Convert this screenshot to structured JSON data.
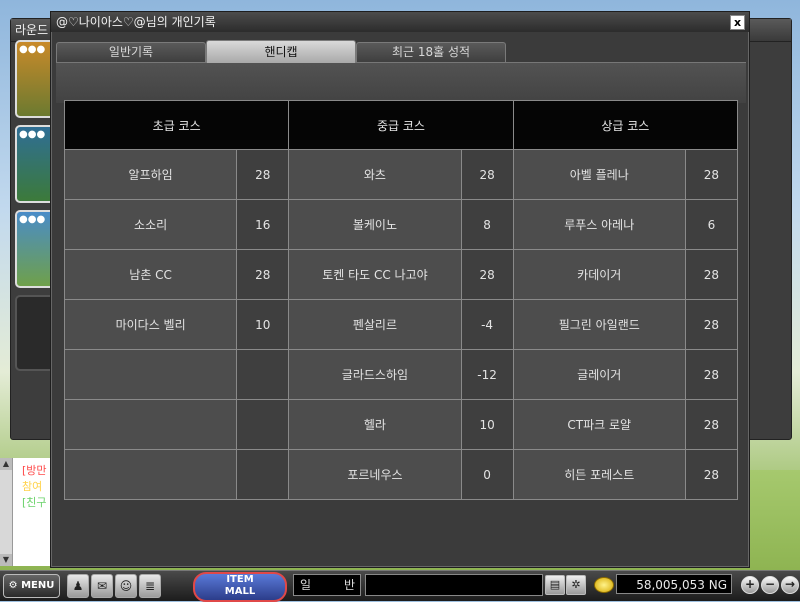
{
  "background": {
    "window_title": "라운드",
    "chat_lines": [
      {
        "text": "[방만",
        "color": "#ff4a4a"
      },
      {
        "text": "참여",
        "color": "#ffd24a"
      },
      {
        "text": "[친구",
        "color": "#6ad26a"
      }
    ]
  },
  "dialog": {
    "title": "@♡나이아스♡@님의 개인기록",
    "close_label": "x",
    "tabs": [
      {
        "label": "일반기록",
        "active": false
      },
      {
        "label": "핸디캡",
        "active": true
      },
      {
        "label": "최근 18홀 성적",
        "active": false
      }
    ]
  },
  "handicap_table": {
    "headers": [
      "초급 코스",
      "중급 코스",
      "상급 코스"
    ],
    "rows": [
      [
        {
          "course": "알프하임",
          "value": "28"
        },
        {
          "course": "와츠",
          "value": "28"
        },
        {
          "course": "아벨 플레나",
          "value": "28"
        }
      ],
      [
        {
          "course": "소소리",
          "value": "16"
        },
        {
          "course": "볼케이노",
          "value": "8"
        },
        {
          "course": "루푸스 아레나",
          "value": "6"
        }
      ],
      [
        {
          "course": "남촌 CC",
          "value": "28"
        },
        {
          "course": "토켄 타도 CC 나고야",
          "value": "28"
        },
        {
          "course": "카데이거",
          "value": "28"
        }
      ],
      [
        {
          "course": "마이다스 벨리",
          "value": "10"
        },
        {
          "course": "펜살리르",
          "value": "-4"
        },
        {
          "course": "필그린 아일랜드",
          "value": "28"
        }
      ],
      [
        {
          "course": "",
          "value": ""
        },
        {
          "course": "글라드스하임",
          "value": "-12"
        },
        {
          "course": "글레이거",
          "value": "28"
        }
      ],
      [
        {
          "course": "",
          "value": ""
        },
        {
          "course": "헬라",
          "value": "10"
        },
        {
          "course": "CT파크 로얄",
          "value": "28"
        }
      ],
      [
        {
          "course": "",
          "value": ""
        },
        {
          "course": "포르네우스",
          "value": "0"
        },
        {
          "course": "히든 포레스트",
          "value": "28"
        }
      ]
    ]
  },
  "bottom_bar": {
    "menu_label": "MENU",
    "item_mall_top": "ITEM",
    "item_mall_bottom": "MALL",
    "chat_mode_a": "일",
    "chat_mode_b": "반",
    "money": "58,005,053 NG",
    "icons": [
      "person-icon",
      "mail-icon",
      "group-icon",
      "list-icon"
    ]
  }
}
